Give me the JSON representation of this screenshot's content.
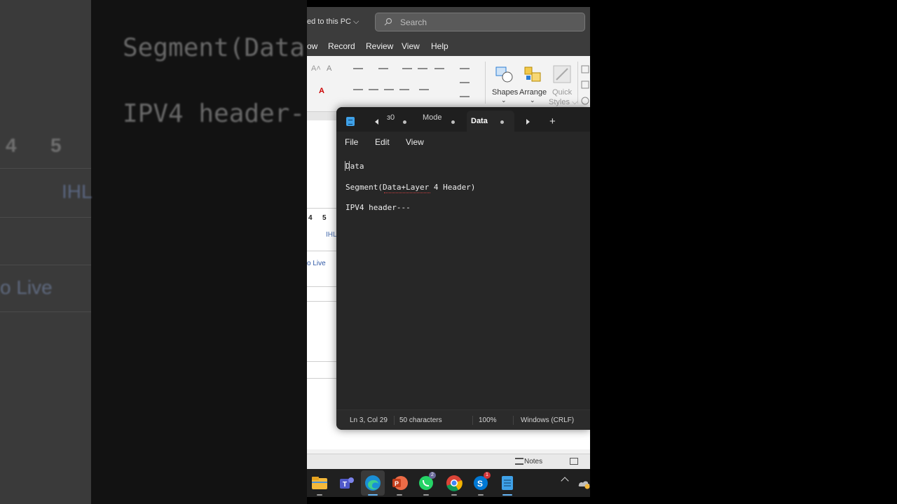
{
  "background_blur": {
    "text_line_1": "Segment(Data",
    "text_line_2": "IPV4 header-",
    "cell_4": "4",
    "cell_5": "5",
    "ihl": "IHL",
    "live": "o Live"
  },
  "word": {
    "saved_text": "ed to this PC ⌵",
    "search_placeholder": "Search",
    "menu": [
      "ow",
      "Record",
      "Review",
      "View",
      "Help"
    ],
    "ribbon": {
      "shapes": "Shapes",
      "arrange": "Arrange",
      "quick": "Quick",
      "styles": "Styles ⌵"
    },
    "table_cells": [
      "4",
      "5"
    ],
    "ihl": "IHL",
    "live_link": "o Live",
    "status_notes": "Notes"
  },
  "notepad": {
    "tabs": {
      "tab1": "ɜ0",
      "tab2": "Mode",
      "active": "Data",
      "new_tab": "+"
    },
    "menu": {
      "file": "File",
      "edit": "Edit",
      "view": "View"
    },
    "lines": {
      "l1": "Data",
      "l2": "Segment(Data+Layer 4 Header)",
      "l3": "IPV4 header---"
    },
    "status": {
      "position": "Ln 3, Col 29",
      "chars": "50 characters",
      "zoom": "100%",
      "eol": "Windows (CRLF)"
    },
    "colors": {
      "background": "#272727",
      "text": "#ececec",
      "icon": "#3fa1e8"
    }
  },
  "taskbar": {
    "apps": [
      "file-explorer-icon",
      "teams-icon",
      "edge-icon",
      "powerpoint-icon",
      "whatsapp-icon",
      "chrome-icon",
      "skype-icon",
      "notepad-icon"
    ],
    "badges": {
      "whatsapp": "2",
      "skype": "1"
    }
  }
}
